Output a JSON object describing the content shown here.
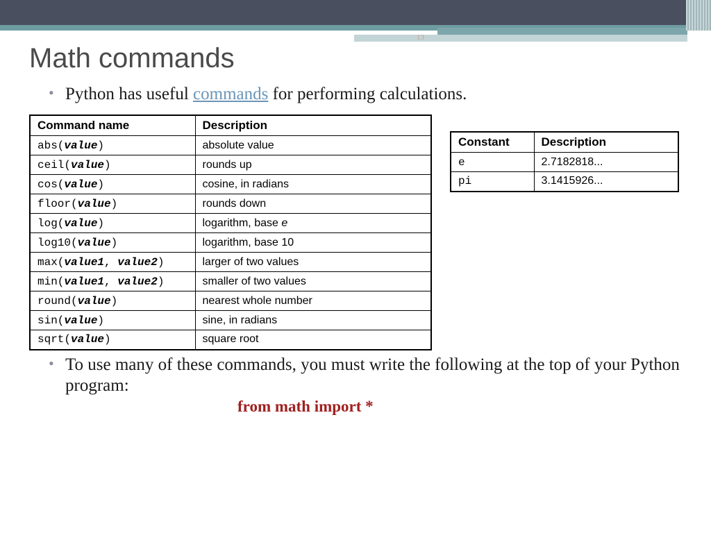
{
  "page_number": "13",
  "title": "Math commands",
  "bullet1_prefix": "Python has useful ",
  "bullet1_link": "commands",
  "bullet1_suffix": " for performing calculations.",
  "cmd_table": {
    "headers": [
      "Command name",
      "Description"
    ],
    "rows": [
      {
        "cmd_pre": "abs(",
        "cmd_arg": "value",
        "cmd_post": ")",
        "desc": "absolute value"
      },
      {
        "cmd_pre": "ceil(",
        "cmd_arg": "value",
        "cmd_post": ")",
        "desc": "rounds up"
      },
      {
        "cmd_pre": "cos(",
        "cmd_arg": "value",
        "cmd_post": ")",
        "desc": "cosine, in radians"
      },
      {
        "cmd_pre": "floor(",
        "cmd_arg": "value",
        "cmd_post": ")",
        "desc": "rounds down"
      },
      {
        "cmd_pre": "log(",
        "cmd_arg": "value",
        "cmd_post": ")",
        "desc_pre": "logarithm, base ",
        "desc_ital": "e"
      },
      {
        "cmd_pre": "log10(",
        "cmd_arg": "value",
        "cmd_post": ")",
        "desc": "logarithm, base 10"
      },
      {
        "cmd_pre": "max(",
        "cmd_arg": "value1",
        "cmd_mid": ", ",
        "cmd_arg2": "value2",
        "cmd_post": ")",
        "desc": "larger of two values"
      },
      {
        "cmd_pre": "min(",
        "cmd_arg": "value1",
        "cmd_mid": ", ",
        "cmd_arg2": "value2",
        "cmd_post": ")",
        "desc": "smaller of two values"
      },
      {
        "cmd_pre": "round(",
        "cmd_arg": "value",
        "cmd_post": ")",
        "desc": "nearest whole number"
      },
      {
        "cmd_pre": "sin(",
        "cmd_arg": "value",
        "cmd_post": ")",
        "desc": "sine, in radians"
      },
      {
        "cmd_pre": "sqrt(",
        "cmd_arg": "value",
        "cmd_post": ")",
        "desc": "square root"
      }
    ]
  },
  "const_table": {
    "headers": [
      "Constant",
      "Description"
    ],
    "rows": [
      {
        "name": "e",
        "value": "2.7182818..."
      },
      {
        "name": "pi",
        "value": "3.1415926..."
      }
    ]
  },
  "bullet2": "To use many of these commands, you must write the following at the top of your Python program:",
  "import_stmt": "from math import *"
}
